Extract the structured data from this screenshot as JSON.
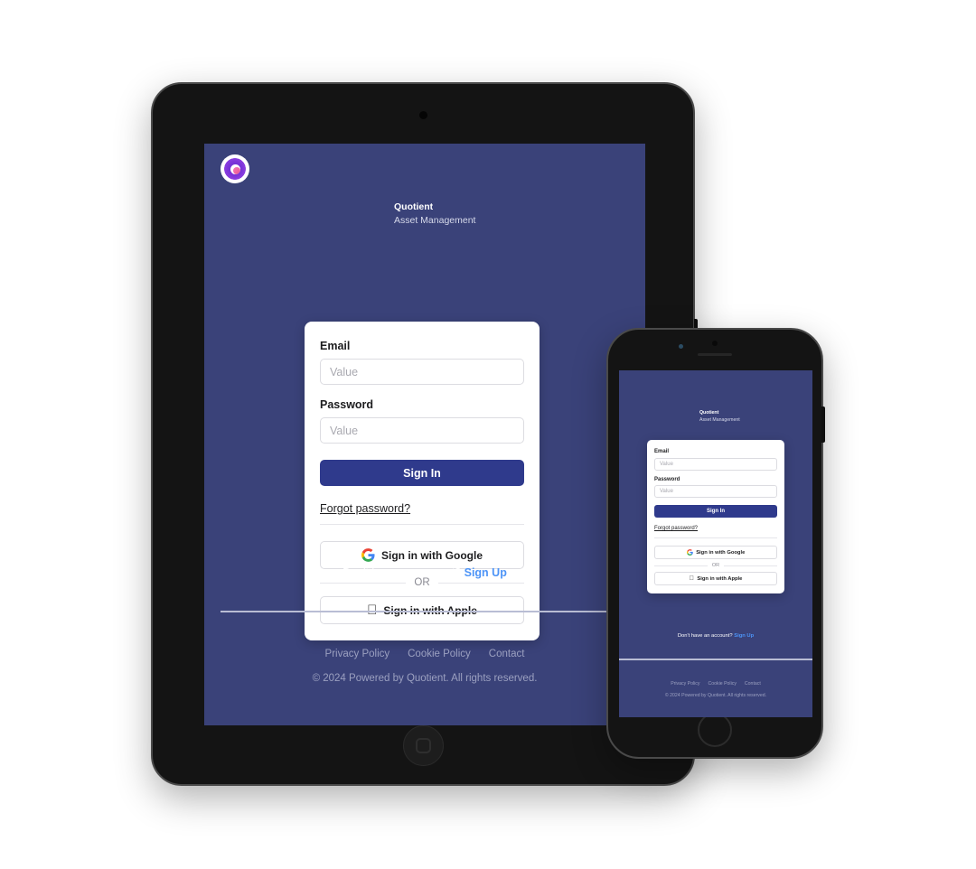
{
  "brand": {
    "name": "Quotient",
    "tagline": "Asset Management",
    "logo_icon": "quotient-circle-logo",
    "accent_color": "#2f3a8c",
    "background_color": "#3a4279",
    "link_color": "#4d94f7"
  },
  "form": {
    "email_label": "Email",
    "email_placeholder": "Value",
    "email_value": "",
    "password_label": "Password",
    "password_placeholder": "Value",
    "password_value": "",
    "sign_in_label": "Sign In",
    "forgot_password_label": "Forgot password?",
    "google_label": "Sign in with Google",
    "google_icon": "google-g-icon",
    "apple_label": "Sign in with Apple",
    "apple_icon": "apple-logo-icon",
    "divider_label": "OR"
  },
  "signup": {
    "prompt": "Don't have an account?",
    "link_label": "Sign Up"
  },
  "footer": {
    "links": [
      "Privacy Policy",
      "Cookie Policy",
      "Contact"
    ],
    "copyright": "© 2024 Powered by Quotient. All rights reserved."
  },
  "devices": {
    "tablet_name": "tablet-mockup",
    "phone_name": "phone-mockup"
  }
}
